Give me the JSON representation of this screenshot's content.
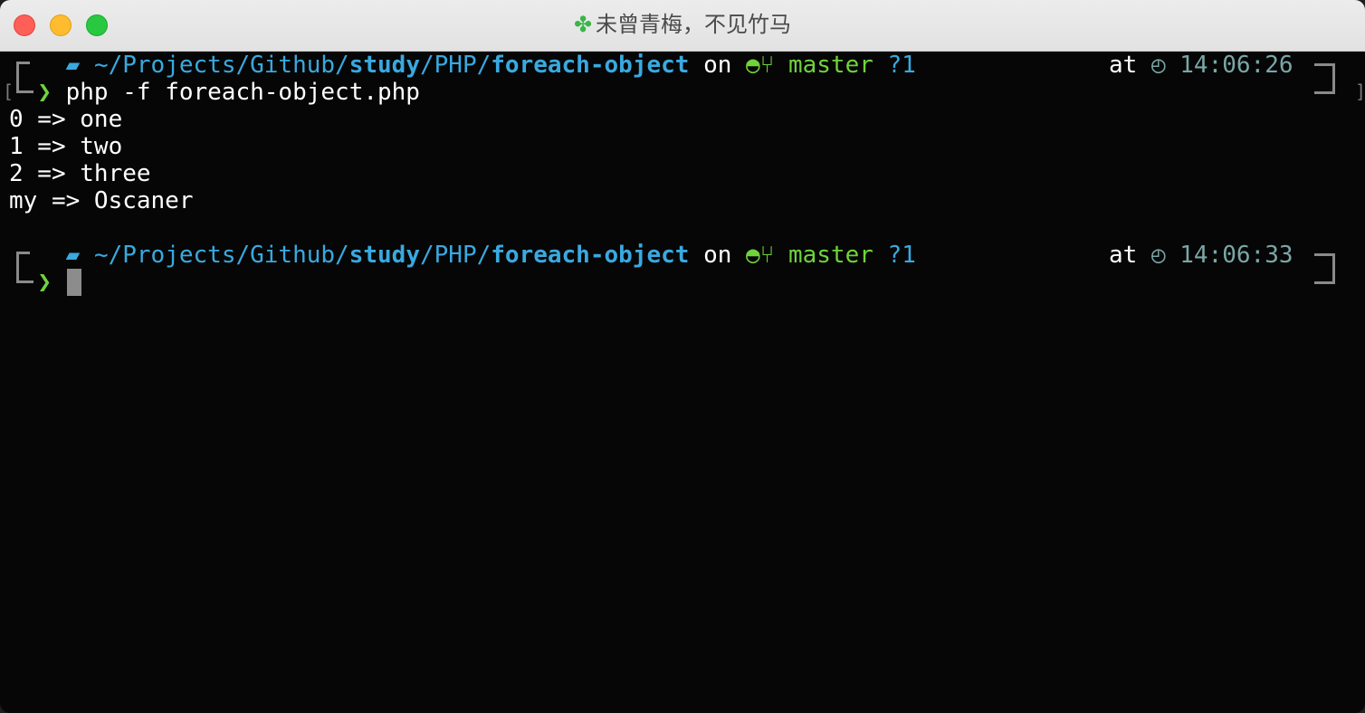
{
  "window": {
    "title_icon": "four-leaf-clover-icon",
    "title": "未曾青梅，不见竹马"
  },
  "prompts": [
    {
      "path_prefix": "~/Projects/Github/",
      "path_study": "study",
      "path_mid": "/PHP/",
      "path_dir": "foreach-object",
      "on": "on",
      "branch": "master",
      "status": "?1",
      "at": "at",
      "time": "14:06:26",
      "command": "php -f foreach-object.php"
    },
    {
      "path_prefix": "~/Projects/Github/",
      "path_study": "study",
      "path_mid": "/PHP/",
      "path_dir": "foreach-object",
      "on": "on",
      "branch": "master",
      "status": "?1",
      "at": "at",
      "time": "14:06:33",
      "command": ""
    }
  ],
  "output": [
    "0 => one",
    "1 => two",
    "2 => three",
    "my => Oscaner"
  ],
  "icons": {
    "os": "apple-icon",
    "folder": "folder-icon",
    "repo": "github-cat-icon",
    "branch": "git-branch-icon",
    "clock": "clock-icon",
    "prompt": "chevron-right-icon"
  },
  "colors": {
    "path": "#39a9e0",
    "git": "#6fd33c",
    "time": "#7aa6a6",
    "background": "#060606"
  }
}
